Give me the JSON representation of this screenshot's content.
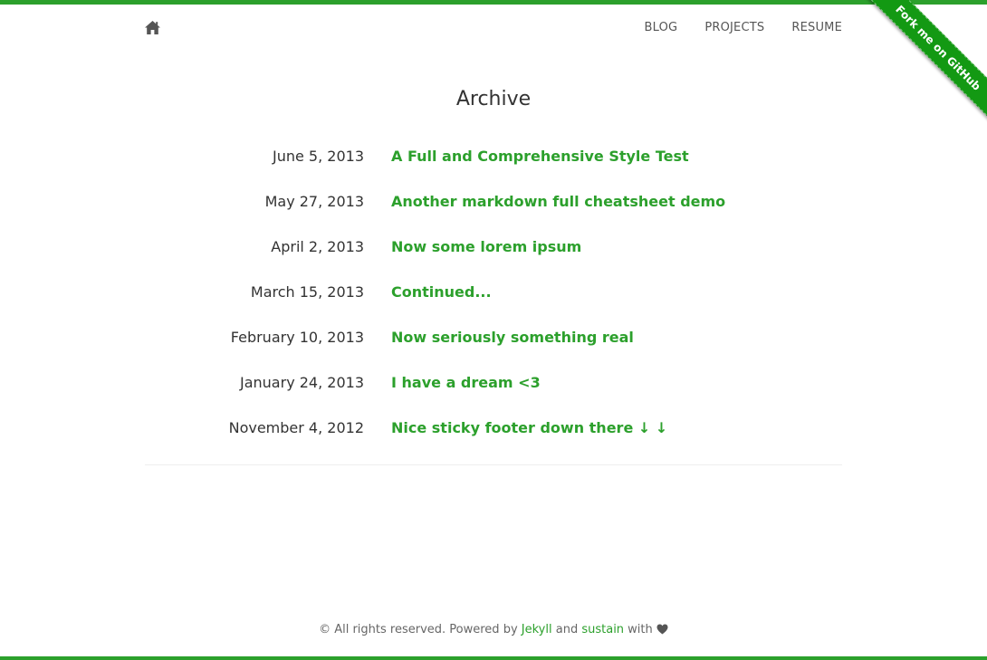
{
  "nav": {
    "items": [
      {
        "label": "BLOG"
      },
      {
        "label": "PROJECTS"
      },
      {
        "label": "RESUME"
      }
    ]
  },
  "ribbon": {
    "label": "Fork me on GitHub"
  },
  "page": {
    "title": "Archive"
  },
  "archive": {
    "posts": [
      {
        "date": "June 5, 2013",
        "title": "A Full and Comprehensive Style Test"
      },
      {
        "date": "May 27, 2013",
        "title": "Another markdown full cheatsheet demo"
      },
      {
        "date": "April 2, 2013",
        "title": "Now some lorem ipsum"
      },
      {
        "date": "March 15, 2013",
        "title": "Continued..."
      },
      {
        "date": "February 10, 2013",
        "title": "Now seriously something real"
      },
      {
        "date": "January 24, 2013",
        "title": "I have a dream <3"
      },
      {
        "date": "November 4, 2012",
        "title": "Nice sticky footer down there ↓ ↓"
      }
    ]
  },
  "footer": {
    "prefix": "© All rights reserved. Powered by ",
    "jekyll_link": "Jekyll",
    "and": " and ",
    "sustain_link": "sustain",
    "with": " with "
  },
  "icons": {
    "home": "home-icon",
    "heart": "heart-icon"
  },
  "colors": {
    "accent": "#2ca02c",
    "ribbon": "#139913",
    "text": "#333333",
    "muted": "#666666"
  }
}
